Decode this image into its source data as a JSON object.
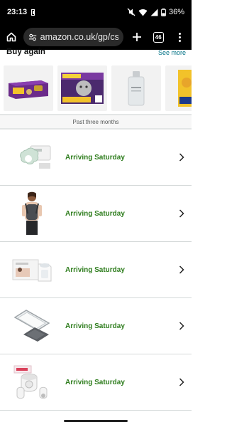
{
  "status_bar": {
    "time": "23:13",
    "battery_percent": "36%"
  },
  "browser": {
    "url": "amazon.co.uk/gp/css",
    "tab_count": "46"
  },
  "buy_again": {
    "title": "Buy again",
    "see_more": "See more",
    "items": [
      {
        "name": "cat-food-pouches-pack",
        "color": "#6b2b8a"
      },
      {
        "name": "whiskas-mega-pack",
        "color": "#4b2a6e"
      },
      {
        "name": "bottle-product",
        "color": "#e9ecee"
      },
      {
        "name": "yellow-pack-product",
        "color": "#f2c22a"
      }
    ]
  },
  "orders": {
    "section_label": "Past three months",
    "items": [
      {
        "status": "Arriving Saturday",
        "icon": "baby-monitor-icon"
      },
      {
        "status": "Arriving Saturday",
        "icon": "baby-carrier-icon"
      },
      {
        "status": "Arriving Saturday",
        "icon": "breast-pump-box-icon"
      },
      {
        "status": "Arriving Saturday",
        "icon": "changing-mat-icon"
      },
      {
        "status": "Arriving Saturday",
        "icon": "wearable-pump-icon"
      }
    ]
  },
  "colors": {
    "status_green": "#2e7d1d",
    "link_teal": "#007185"
  }
}
